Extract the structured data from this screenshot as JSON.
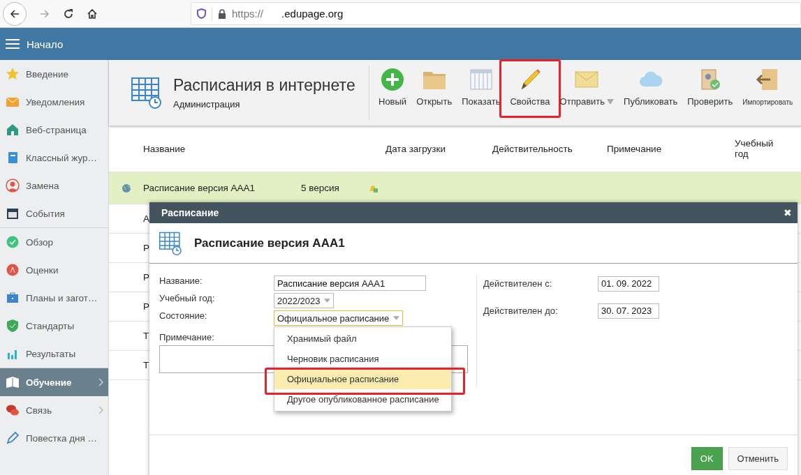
{
  "browser": {
    "url_scheme": "https://",
    "url_domain": ".edupage.org"
  },
  "app_header": {
    "title": "Начало"
  },
  "sidebar": {
    "groups": [
      [
        {
          "label": "Введение",
          "kind": "star",
          "selected": false,
          "has_submenu": false
        },
        {
          "label": "Уведомления",
          "kind": "envelope",
          "selected": false,
          "has_submenu": false
        },
        {
          "label": "Веб-страница",
          "kind": "house",
          "selected": false,
          "has_submenu": false
        },
        {
          "label": "Классный жур…",
          "kind": "notebook",
          "selected": false,
          "has_submenu": false
        },
        {
          "label": "Замена",
          "kind": "person",
          "selected": false,
          "has_submenu": false
        },
        {
          "label": "События",
          "kind": "calendar",
          "selected": false,
          "has_submenu": false
        }
      ],
      [
        {
          "label": "Обзор",
          "kind": "check",
          "selected": false,
          "has_submenu": false
        },
        {
          "label": "Оценки",
          "kind": "grade",
          "selected": false,
          "has_submenu": false
        },
        {
          "label": "Планы и загот…",
          "kind": "briefcase",
          "selected": false,
          "has_submenu": false
        },
        {
          "label": "Стандарты",
          "kind": "shield",
          "selected": false,
          "has_submenu": false
        },
        {
          "label": "Результаты",
          "kind": "bars",
          "selected": false,
          "has_submenu": false
        }
      ],
      [
        {
          "label": "Обучение",
          "kind": "book",
          "selected": true,
          "has_submenu": true
        },
        {
          "label": "Связь",
          "kind": "chat",
          "selected": false,
          "has_submenu": true
        },
        {
          "label": "Повестка дня …",
          "kind": "pen",
          "selected": false,
          "has_submenu": false
        }
      ]
    ]
  },
  "page": {
    "title": "Расписания в интернете",
    "subtitle": "Администрация"
  },
  "toolbar": [
    {
      "label": "Новый",
      "kind": "plus",
      "annotated": false,
      "has_menu": false
    },
    {
      "label": "Открыть",
      "kind": "folder",
      "annotated": false,
      "has_menu": false
    },
    {
      "label": "Показать",
      "kind": "grid",
      "annotated": false,
      "has_menu": false
    },
    {
      "label": "Свойства",
      "kind": "pencil",
      "annotated": true,
      "has_menu": false
    },
    {
      "label": "Отправить",
      "kind": "envelope",
      "annotated": false,
      "has_menu": true
    },
    {
      "label": "Публиковать",
      "kind": "cloud",
      "annotated": false,
      "has_menu": false
    },
    {
      "label": "Проверить",
      "kind": "badge",
      "annotated": false,
      "has_menu": false
    },
    {
      "label": "Импортировать",
      "kind": "import",
      "annotated": false,
      "has_menu": false
    }
  ],
  "table": {
    "columns": [
      "Название",
      "Дата загрузки",
      "Действительность",
      "Примечание",
      "Учебный год"
    ],
    "rows": [
      {
        "name": "Расписание версия AAA1",
        "column_2": "5 версия",
        "selected": true
      },
      {
        "name": "А",
        "selected": false
      },
      {
        "name": "Р",
        "selected": false
      },
      {
        "name": "Р",
        "selected": false
      },
      {
        "name": "Р",
        "selected": false
      },
      {
        "name": "Т",
        "selected": false
      },
      {
        "name": "Т",
        "selected": false
      }
    ]
  },
  "dialog": {
    "title": "Расписание",
    "close": "✖",
    "heading": "Расписание версия AAA1",
    "fields": [
      {
        "label": "Название:",
        "kind": "text",
        "value": "Расписание версия AAA1"
      },
      {
        "label": "Учебный год:",
        "kind": "select",
        "value": "2022/2023",
        "focused": false
      },
      {
        "label": "Состояние:",
        "kind": "select",
        "value": "Официальное расписание",
        "focused": true
      },
      {
        "label": "Примечание:",
        "kind": "textarea"
      }
    ],
    "dates": [
      {
        "label": "Действителен с:",
        "value": "01. 09. 2022"
      },
      {
        "label": "Действителен до:",
        "value": "30. 07. 2023"
      }
    ],
    "dropdown": [
      {
        "label": "Хранимый файл",
        "selected": false,
        "annotated": false
      },
      {
        "label": "Черновик расписания",
        "selected": false,
        "annotated": false
      },
      {
        "label": "Официальное расписание",
        "selected": true,
        "annotated": true
      },
      {
        "label": "Другое опубликованное расписание",
        "selected": false,
        "annotated": false
      }
    ],
    "buttons": [
      {
        "label": "OK",
        "kind": "primary"
      },
      {
        "label": "Отменить",
        "kind": "secondary"
      }
    ]
  }
}
